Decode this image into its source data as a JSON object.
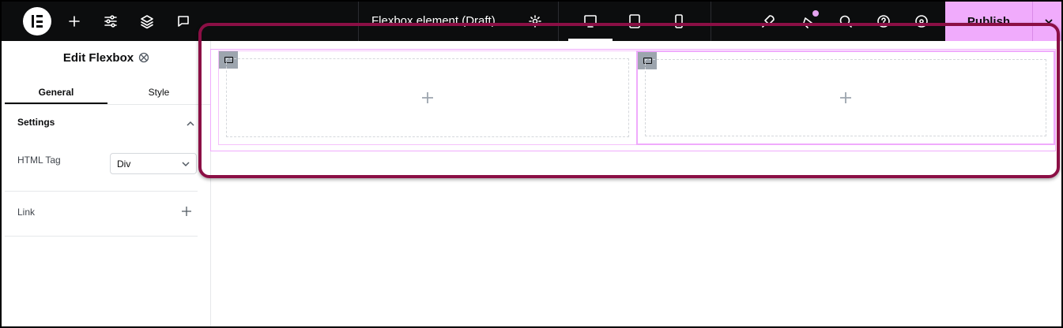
{
  "topbar": {
    "document_title": "Flexbox element (Draft)",
    "publish_label": "Publish"
  },
  "panel": {
    "title": "Edit Flexbox",
    "tabs": [
      {
        "label": "General",
        "active": true
      },
      {
        "label": "Style",
        "active": false
      }
    ],
    "section_title": "Settings",
    "html_tag_label": "HTML Tag",
    "html_tag_value": "Div",
    "link_label": "Link"
  },
  "colors": {
    "accent": "#f0abfc",
    "highlight": "#8b0f45",
    "topbar": "#0c0d0e"
  },
  "icons": [
    "elementor-logo-icon",
    "plus-icon",
    "sliders-icon",
    "layers-icon",
    "comment-icon",
    "settings-icon",
    "desktop-icon",
    "tablet-icon",
    "mobile-icon",
    "rocket-icon",
    "notifications-icon",
    "search-icon",
    "help-icon",
    "eye-icon",
    "chevron-down-icon",
    "flexbox-icon"
  ]
}
